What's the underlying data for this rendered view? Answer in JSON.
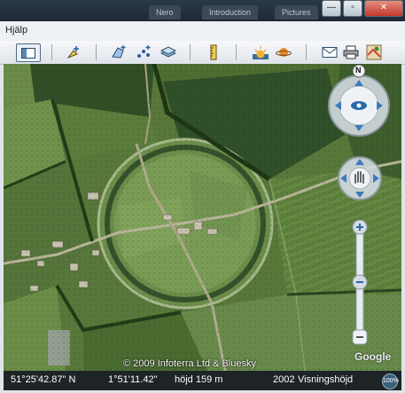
{
  "window": {
    "tabs": [
      "Nero",
      "Introduction",
      "Pictures"
    ],
    "buttons": {
      "minimize": "—",
      "maximize": "▫",
      "close": "✕"
    }
  },
  "menubar": {
    "items": [
      "Hjälp"
    ]
  },
  "toolbar": {
    "icons": [
      "sidebar-icon",
      "placemark-icon",
      "polygon-icon",
      "path-icon",
      "overlay-icon",
      "ruler-icon",
      "sunlight-icon",
      "planet-icon",
      "email-icon",
      "print-icon",
      "maps-icon"
    ]
  },
  "map": {
    "north_label": "N",
    "copyright": "© 2009 Infoterra Ltd & Bluesky",
    "logo": "Google"
  },
  "status_bar": {
    "latitude": "51°25'42.87\" N",
    "longitude": "1°51'11.42\"",
    "elevation": "höjd  159 m",
    "imagery_date": "2002",
    "eye_alt": "Visningshöjd",
    "streaming": "100%"
  },
  "colors": {
    "toolbar_active": "#4e6a85",
    "status_bg": "#1e2325",
    "nav_ring": "#c8d2da"
  }
}
